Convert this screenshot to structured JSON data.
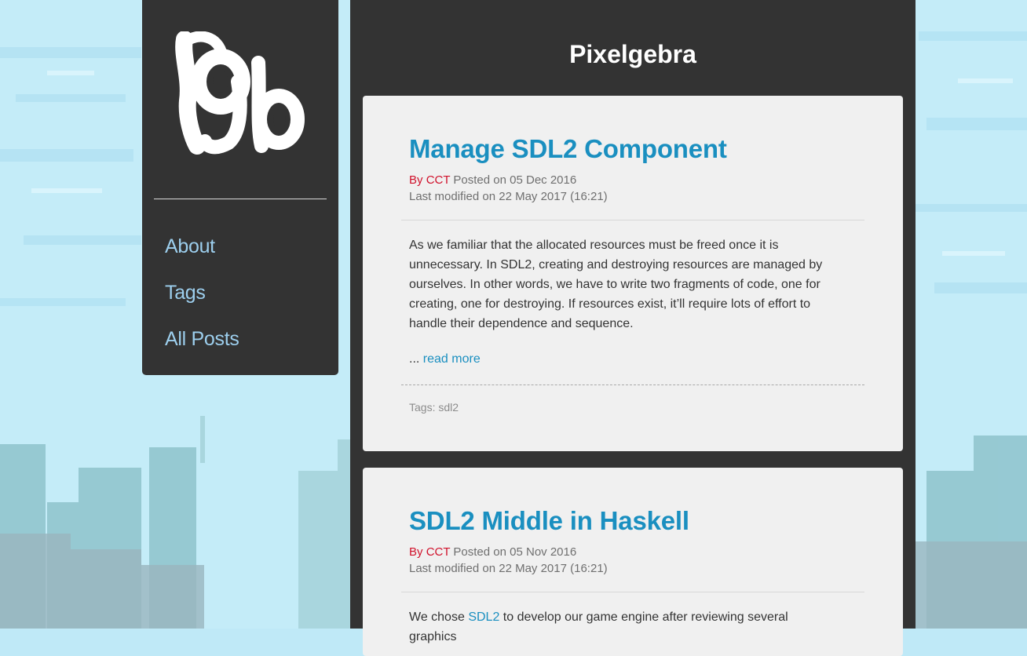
{
  "site": {
    "title": "Pixelgebra"
  },
  "sidebar": {
    "logo_icon": "pixelgebra-pg-logo",
    "nav": [
      {
        "label": "About"
      },
      {
        "label": "Tags"
      },
      {
        "label": "All Posts"
      }
    ]
  },
  "posts": [
    {
      "title": "Manage SDL2 Component",
      "by_label": "By",
      "author": "CCT",
      "posted": "Posted on 05 Dec 2016",
      "modified": "Last modified on 22 May 2017 (16:21)",
      "excerpt": "As we familiar that the allocated resources must be freed once it is unnecessary. In SDL2, creating and destroying resources are managed by ourselves. In other words, we have to write two fragments of code, one for creating, one for destroying. If resources exist, it’ll require lots of effort to handle their dependence and sequence.",
      "more_prefix": "...",
      "read_more": "read more",
      "tags_label": "Tags:",
      "tag": "sdl2"
    },
    {
      "title": "SDL2 Middle in Haskell",
      "by_label": "By",
      "author": "CCT",
      "posted": "Posted on 05 Nov 2016",
      "modified": "Last modified on 22 May 2017 (16:21)",
      "excerpt_before": "We chose",
      "excerpt_link": "SDL2",
      "excerpt_after": "to develop our game engine after reviewing several graphics"
    }
  ],
  "colors": {
    "panel": "#333333",
    "card": "#f0f0f0",
    "link": "#1a8fc0",
    "nav_link": "#9dcfee",
    "author": "#d0112b",
    "sky": "#bfe9f7",
    "buildings": "#8fbfc9"
  }
}
